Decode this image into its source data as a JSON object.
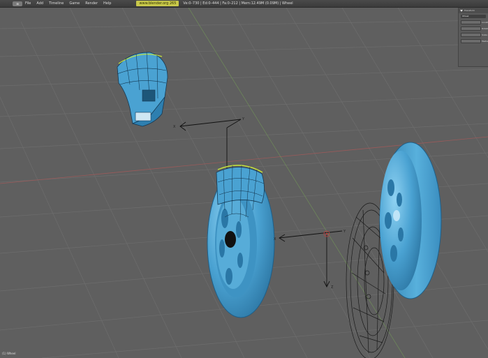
{
  "header": {
    "menus": [
      "File",
      "Add",
      "Timeline",
      "Game",
      "Render",
      "Help"
    ],
    "url": "www.blender.org 265",
    "stats": "Ve:0–730 | Ed:0–444 | Fa:0–212 | Mem:12.49M (0.09M) | Wheel"
  },
  "npanel": {
    "title": "Transform",
    "object_label": "Wheel",
    "fields": [
      "Location",
      "Rotation",
      "Scale"
    ],
    "mode_label": "Median"
  },
  "viewport": {
    "axis_x_label": "X",
    "axis_y_label": "Y",
    "axis_z_label": "Z",
    "corner_label": "(1) Wheel"
  },
  "colors": {
    "viewport_bg": "#5f5f5f",
    "grid_line": "#6b6b6b",
    "wheel_blue": "#4a9fd0",
    "wheel_highlight": "#7cc6ec",
    "wire_black": "#111111",
    "selected_edge": "#c8e63a"
  }
}
